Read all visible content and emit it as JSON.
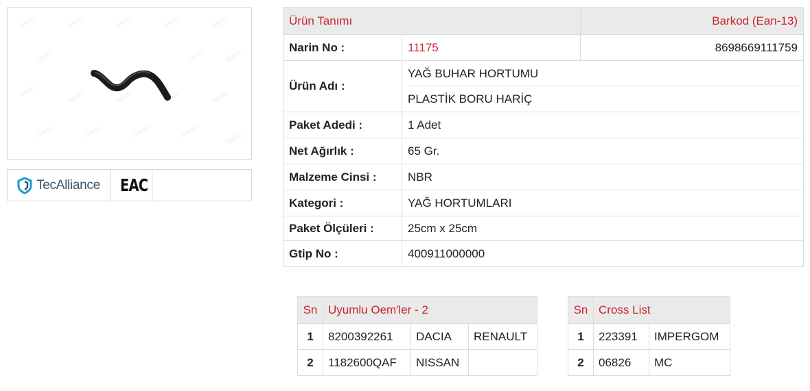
{
  "product_image": {
    "description": "black-rubber-hose",
    "watermark": "narin"
  },
  "logos": {
    "tecalliance": "TecAlliance",
    "eac": "EAC"
  },
  "info": {
    "header_left": "Ürün Tanımı",
    "header_right": "Barkod (Ean-13)",
    "rows": [
      {
        "label": "Narin No :",
        "value": "11175",
        "extra": "8698669111759"
      },
      {
        "label": "Ürün Adı :",
        "value": "YAĞ BUHAR HORTUMU",
        "value2": "PLASTİK BORU HARİÇ"
      },
      {
        "label": "Paket Adedi :",
        "value": "1 Adet"
      },
      {
        "label": "Net Ağırlık :",
        "value": "65 Gr."
      },
      {
        "label": "Malzeme Cinsi :",
        "value": "NBR"
      },
      {
        "label": "Kategori :",
        "value": "YAĞ HORTUMLARI"
      },
      {
        "label": "Paket Ölçüleri :",
        "value": "25cm x 25cm"
      },
      {
        "label": "Gtip No :",
        "value": "400911000000"
      }
    ]
  },
  "oem": {
    "sn_header": "Sn",
    "title": "Uyumlu Oem'ler - 2",
    "rows": [
      {
        "sn": "1",
        "code": "8200392261",
        "brand": "DACIA",
        "brand2": "RENAULT"
      },
      {
        "sn": "2",
        "code": "1182600QAF",
        "brand": "NISSAN",
        "brand2": ""
      }
    ]
  },
  "cross": {
    "sn_header": "Sn",
    "title": "Cross List",
    "rows": [
      {
        "sn": "1",
        "code": "223391",
        "brand": "IMPERGOM"
      },
      {
        "sn": "2",
        "code": "06826",
        "brand": "MC"
      }
    ]
  },
  "colors": {
    "accent": "#c9242b",
    "header_bg": "#eaeaea",
    "border": "#dcdcdc"
  }
}
